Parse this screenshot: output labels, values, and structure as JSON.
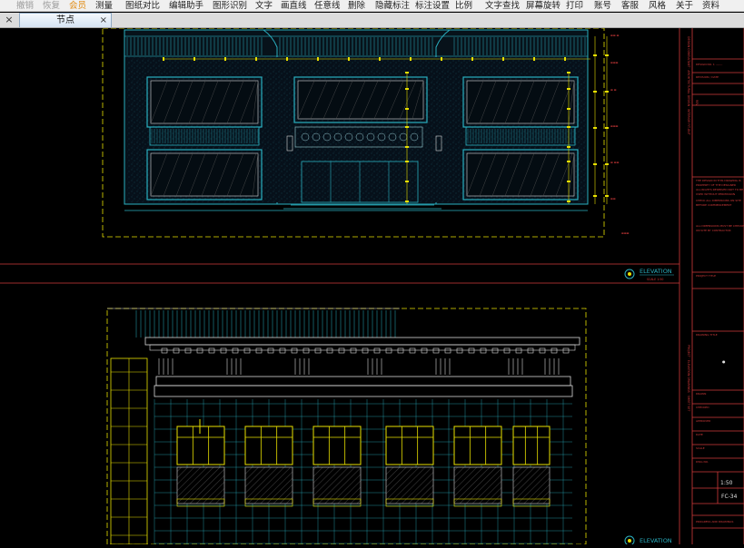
{
  "toolbar": {
    "items": [
      {
        "label": "撤销",
        "state": "dim"
      },
      {
        "label": "恢复",
        "state": "dim"
      },
      {
        "label": "会员",
        "state": "member"
      },
      {
        "label": "测量",
        "state": "normal"
      },
      {
        "label": "图纸对比",
        "state": "normal"
      },
      {
        "label": "编辑助手",
        "state": "normal"
      },
      {
        "label": "图形识别",
        "state": "normal"
      },
      {
        "label": "文字",
        "state": "normal"
      },
      {
        "label": "画直线",
        "state": "normal"
      },
      {
        "label": "任意线",
        "state": "normal"
      },
      {
        "label": "删除",
        "state": "normal"
      },
      {
        "label": "隐藏标注",
        "state": "normal"
      },
      {
        "label": "标注设置",
        "state": "normal"
      },
      {
        "label": "比例",
        "state": "normal"
      },
      {
        "label": "文字查找",
        "state": "normal"
      },
      {
        "label": "屏幕旋转",
        "state": "normal"
      },
      {
        "label": "打印",
        "state": "normal"
      },
      {
        "label": "账号",
        "state": "normal"
      },
      {
        "label": "客服",
        "state": "normal"
      },
      {
        "label": "风格",
        "state": "normal"
      },
      {
        "label": "关于",
        "state": "normal"
      },
      {
        "label": "资料",
        "state": "normal"
      }
    ]
  },
  "tabs": {
    "active_label": "节点",
    "close_symbol": "×",
    "panel_close_symbol": "×"
  },
  "drawing": {
    "elevation_label_1": "ELEVATION",
    "elevation_label_2": "ELEVATION",
    "scale_text_1": "SCALE 1:50",
    "sheet_scale": "1:50",
    "sheet_number": "FC-34"
  },
  "colors": {
    "toolbar_bg": "#f0f0f0",
    "canvas_bg": "#000000",
    "frame_red": "#d23a3a",
    "cad_yellow": "#e8e000",
    "cad_cyan": "#2ab0c0",
    "cad_white": "#d8d8d8",
    "tab_active": "#d5e3f2"
  }
}
